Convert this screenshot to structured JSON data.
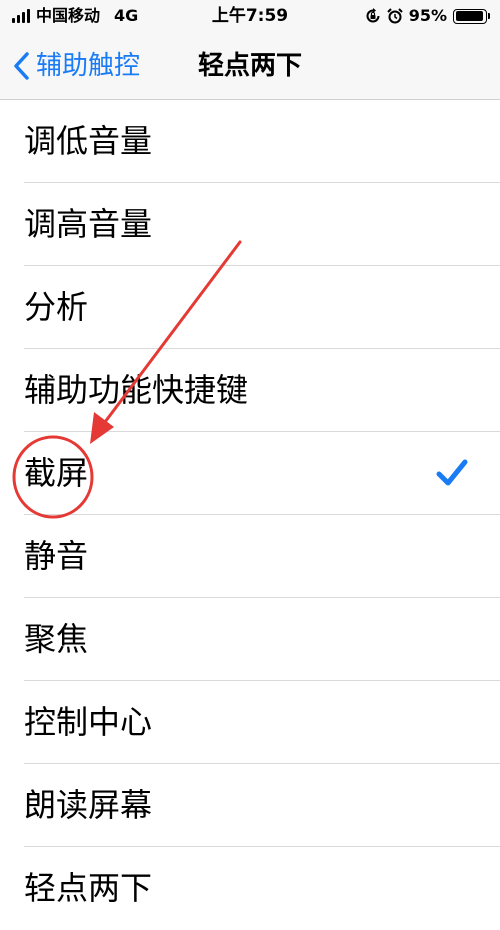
{
  "status_bar": {
    "carrier": "中国移动",
    "network": "4G",
    "time": "上午7:59",
    "battery": "95%",
    "battery_level": 0.95,
    "icons": [
      "signal-icon",
      "orientation-lock-icon",
      "alarm-icon",
      "battery-icon"
    ]
  },
  "nav": {
    "back_label": "辅助触控",
    "title": "轻点两下"
  },
  "list": {
    "items": [
      {
        "label": "调低音量"
      },
      {
        "label": "调高音量"
      },
      {
        "label": "分析"
      },
      {
        "label": "辅助功能快捷键"
      },
      {
        "label": "截屏",
        "selected": true
      },
      {
        "label": "静音"
      },
      {
        "label": "聚焦"
      },
      {
        "label": "控制中心"
      },
      {
        "label": "朗读屏幕"
      },
      {
        "label": "轻点两下"
      }
    ]
  },
  "colors": {
    "accent": "#1a7cf5",
    "annotation": "#e53935"
  }
}
